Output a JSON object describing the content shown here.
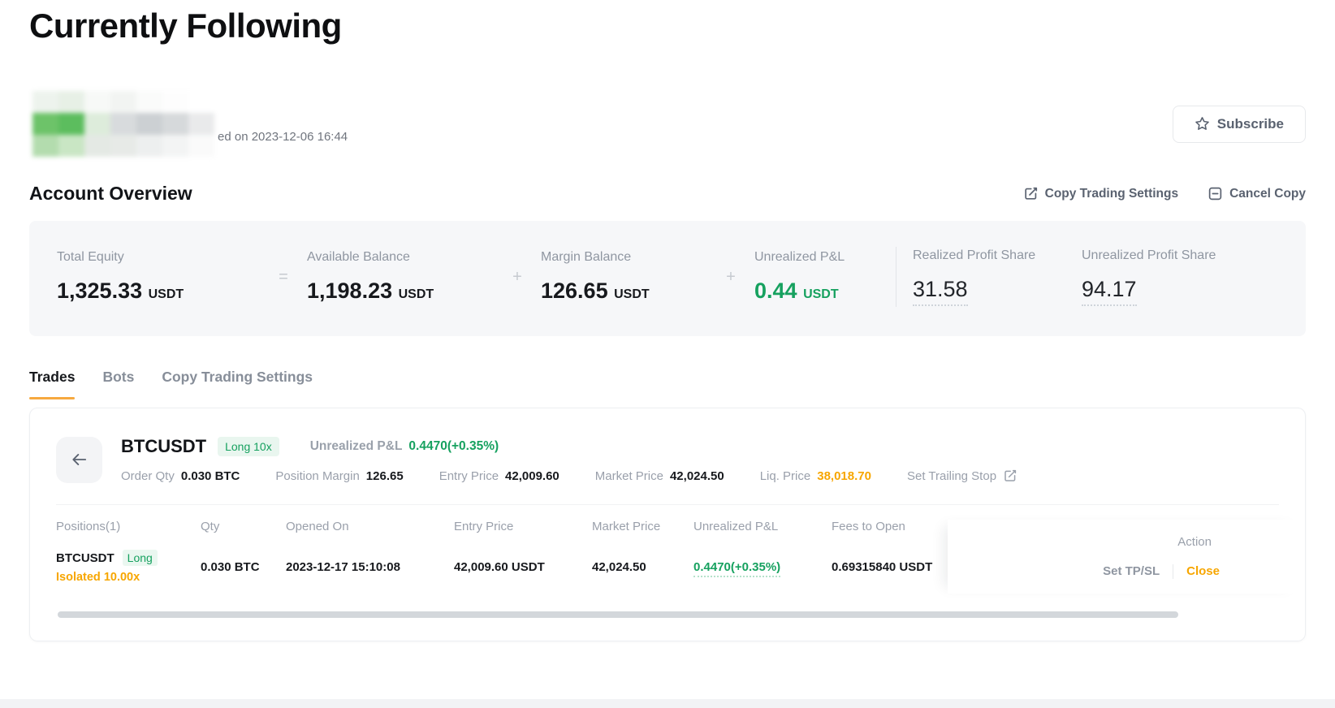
{
  "page": {
    "title": "Currently Following"
  },
  "colors": {
    "green": "#16a15f",
    "orange": "#f7a600",
    "tab_underline": "#f7a93f"
  },
  "profile": {
    "copied_on_partial": "ed on 2023-12-06 16:44",
    "subscribe_label": "Subscribe",
    "avatar_mosaic": [
      "#edf3ed",
      "#e7f0e6",
      "#f7f9f7",
      "#f2f4f2",
      "#fafbfa",
      "#fdfdfd",
      "#ffffff",
      "#6dc369",
      "#5cbd5e",
      "#ddecdb",
      "#d8dbdd",
      "#ccd0d3",
      "#d6d9db",
      "#e9eaeb",
      "#b3dcae",
      "#c9e6c4",
      "#e4e9e4",
      "#e7eae7",
      "#edefef",
      "#f3f4f4",
      "#fafafa"
    ]
  },
  "account_overview": {
    "title": "Account Overview",
    "copy_trading_settings_label": "Copy Trading Settings",
    "cancel_copy_label": "Cancel Copy",
    "operators": {
      "eq": "=",
      "plus1": "+",
      "plus2": "+"
    },
    "stats": {
      "total_equity": {
        "label": "Total Equity",
        "value": "1,325.33",
        "unit": "USDT"
      },
      "available_balance": {
        "label": "Available Balance",
        "value": "1,198.23",
        "unit": "USDT"
      },
      "margin_balance": {
        "label": "Margin Balance",
        "value": "126.65",
        "unit": "USDT"
      },
      "unrealized_pnl": {
        "label": "Unrealized P&L",
        "value": "0.44",
        "unit": "USDT"
      },
      "realized_profit_share": {
        "label": "Realized Profit Share",
        "value": "31.58"
      },
      "unrealized_profit_share": {
        "label": "Unrealized Profit Share",
        "value": "94.17"
      }
    }
  },
  "tabs": {
    "trades": "Trades",
    "bots": "Bots",
    "copy_trading_settings": "Copy Trading Settings"
  },
  "position_card": {
    "symbol": "BTCUSDT",
    "side_badge": "Long 10x",
    "unrealized_pnl_label": "Unrealized P&L",
    "unrealized_pnl_value": "0.4470(+0.35%)",
    "details": {
      "order_qty": {
        "label": "Order Qty",
        "value": "0.030 BTC"
      },
      "position_margin": {
        "label": "Position Margin",
        "value": "126.65"
      },
      "entry_price": {
        "label": "Entry Price",
        "value": "42,009.60"
      },
      "market_price": {
        "label": "Market Price",
        "value": "42,024.50"
      },
      "liq_price": {
        "label": "Liq. Price",
        "value": "38,018.70"
      },
      "set_trailing_stop_label": "Set Trailing Stop"
    },
    "table": {
      "headers": {
        "positions": "Positions(1)",
        "qty": "Qty",
        "opened_on": "Opened On",
        "entry_price": "Entry Price",
        "market_price": "Market Price",
        "unrealized_pnl": "Unrealized P&L",
        "fees_to_open": "Fees to Open",
        "action": "Action"
      },
      "row": {
        "symbol": "BTCUSDT",
        "side": "Long",
        "mode": "Isolated 10.00x",
        "qty": "0.030 BTC",
        "opened_on": "2023-12-17 15:10:08",
        "entry_price": "42,009.60 USDT",
        "market_price": "42,024.50",
        "unrealized_pnl": "0.4470(+0.35%)",
        "fees_to_open": "0.69315840 USDT",
        "set_tpsl_label": "Set TP/SL",
        "close_label": "Close"
      }
    }
  }
}
